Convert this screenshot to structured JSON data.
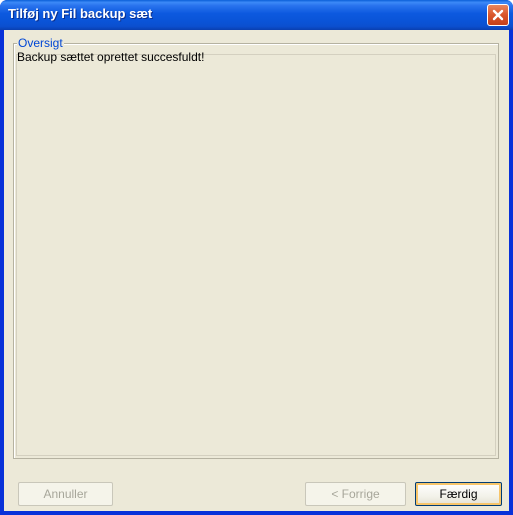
{
  "window": {
    "title": "Tilføj ny Fil backup sæt",
    "close_icon": "close-icon"
  },
  "overview": {
    "legend": "Oversigt",
    "message": "Backup sættet oprettet succesfuldt!"
  },
  "buttons": {
    "cancel_label": "Annuller",
    "back_label": "< Forrige",
    "finish_label": "Færdig"
  },
  "colors": {
    "titlebar": "#0a54d8",
    "close_button": "#d9562b",
    "client_bg": "#ece9d8",
    "legend_text": "#0046d5"
  }
}
